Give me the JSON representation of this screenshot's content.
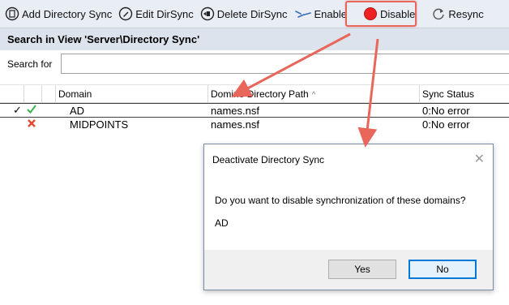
{
  "toolbar": {
    "add": "Add Directory Sync",
    "edit": "Edit DirSync",
    "delete": "Delete DirSync",
    "enable": "Enable",
    "disable": "Disable",
    "resync": "Resync"
  },
  "view": {
    "title": "Search in View 'Server\\Directory Sync'",
    "search_label": "Search for",
    "search_value": ""
  },
  "grid": {
    "columns": [
      "Domain",
      "Domino Directory Path",
      "Sync Status"
    ],
    "rows": [
      {
        "selected": true,
        "status_icon": "check-icon",
        "domain": "AD",
        "path": "names.nsf",
        "status": "0:No error"
      },
      {
        "selected": false,
        "status_icon": "cross-icon",
        "domain": "MIDPOINTS",
        "path": "names.nsf",
        "status": "0:No error"
      }
    ]
  },
  "dialog": {
    "title": "Deactivate Directory Sync",
    "message": "Do you want to disable synchronization of these domains?",
    "item": "AD",
    "yes": "Yes",
    "no": "No",
    "close_glyph": "✕"
  },
  "colors": {
    "highlight": "#e8665a",
    "disable_icon": "#ee2222",
    "primary_button_border": "#0078d7"
  }
}
